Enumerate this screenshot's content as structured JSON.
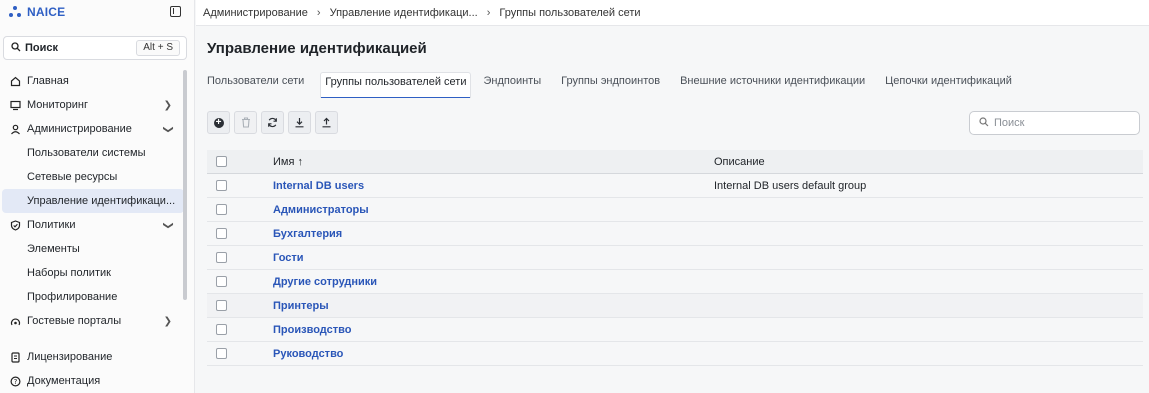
{
  "app": {
    "name": "NAICE"
  },
  "sidebar": {
    "search_label": "Поиск",
    "search_shortcut": "Alt + S",
    "items": [
      {
        "label": "Главная",
        "icon": "home-icon"
      },
      {
        "label": "Мониторинг",
        "icon": "monitor-icon"
      },
      {
        "label": "Администрирование",
        "icon": "user-icon"
      },
      {
        "label": "Пользователи системы"
      },
      {
        "label": "Сетевые ресурсы"
      },
      {
        "label": "Управление идентификаци..."
      },
      {
        "label": "Политики",
        "icon": "shield-icon"
      },
      {
        "label": "Элементы"
      },
      {
        "label": "Наборы политик"
      },
      {
        "label": "Профилирование"
      },
      {
        "label": "Гостевые порталы",
        "icon": "portal-icon"
      },
      {
        "label": "Лицензирование",
        "icon": "license-icon"
      },
      {
        "label": "Документация",
        "icon": "help-icon"
      }
    ]
  },
  "breadcrumb": [
    "Администрирование",
    "Управление идентификаци...",
    "Группы пользователей сети"
  ],
  "page": {
    "title": "Управление идентификацией"
  },
  "tabs": [
    "Пользователи сети",
    "Группы пользователей сети",
    "Эндпоинты",
    "Группы эндпоинтов",
    "Внешние источники идентификации",
    "Цепочки идентификаций"
  ],
  "search": {
    "placeholder": "Поиск"
  },
  "table": {
    "headers": {
      "name": "Имя ↑",
      "description": "Описание"
    },
    "rows": [
      {
        "name": "Internal DB users",
        "description": "Internal DB users default group"
      },
      {
        "name": "Администраторы",
        "description": ""
      },
      {
        "name": "Бухгалтерия",
        "description": ""
      },
      {
        "name": "Гости",
        "description": ""
      },
      {
        "name": "Другие сотрудники",
        "description": ""
      },
      {
        "name": "Принтеры",
        "description": ""
      },
      {
        "name": "Производство",
        "description": ""
      },
      {
        "name": "Руководство",
        "description": ""
      }
    ]
  },
  "colors": {
    "accent": "#2f5fc4",
    "link": "#2a56b8"
  }
}
